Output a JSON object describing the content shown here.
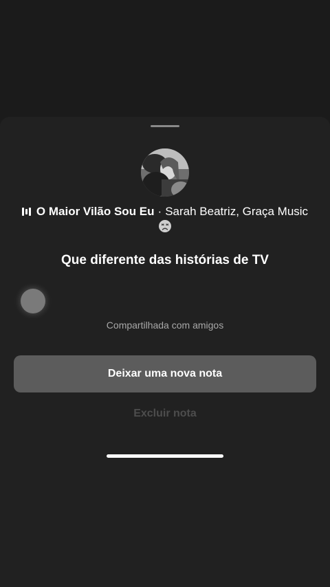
{
  "note": {
    "music": {
      "icon": "music-bars-icon",
      "title": "O Maior Vilão Sou Eu",
      "separator": "·",
      "artists": "Sarah Beatriz, Graça Music"
    },
    "emoji": "sad-face-emoji",
    "text": "Que diferente das histórias de TV",
    "shared_with": "Compartilhada com amigos"
  },
  "actions": {
    "leave_new_note": "Deixar uma nova nota",
    "delete_note": "Excluir nota"
  },
  "colors": {
    "sheet_bg": "#212121",
    "button_bg": "#5c5c5c",
    "text_primary": "#ffffff",
    "text_secondary": "#a8a8a8",
    "text_disabled": "#4d4d4d"
  }
}
